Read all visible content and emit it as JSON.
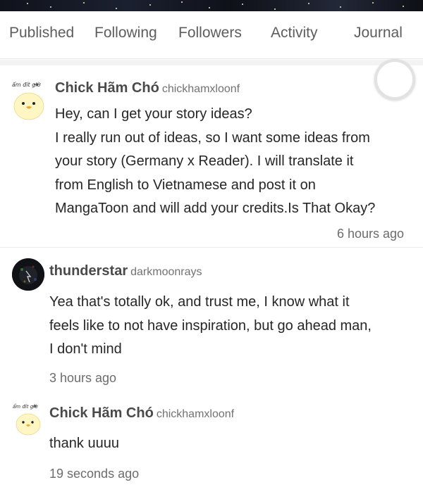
{
  "tabs": [
    {
      "label": "Published"
    },
    {
      "label": "Following"
    },
    {
      "label": "Followers"
    },
    {
      "label": "Activity"
    },
    {
      "label": "Journal"
    }
  ],
  "comments": [
    {
      "author": "Chick Hãm Chó",
      "handle": "chickhamxloonf",
      "avatar_caption": "ẩm đít giờ",
      "lines": [
        "Hey, can I get your story ideas?",
        "I really run out of ideas, so I want some ideas from",
        "your story (Germany x Reader). I will translate it",
        "from English to Vietnamese and post it on",
        "MangaToon and will add your credits.Is That Okay?"
      ],
      "time": "6 hours ago"
    },
    {
      "author": "thunderstar",
      "handle": "darkmoonrays",
      "lines": [
        "Yea that's totally ok, and trust me, I know what it",
        "feels like to not have inspiration, but go ahead man,",
        "I don't mind"
      ],
      "time": "3 hours ago"
    },
    {
      "author": "Chick Hãm Chó",
      "handle": "chickhamxloonf",
      "avatar_caption": "ẩm đít giờ",
      "lines": [
        "thank uuuu"
      ],
      "time": "19 seconds ago"
    }
  ],
  "colors": {
    "tab_text": "#5d5d5d",
    "author_text": "#4a4a4a",
    "meta_text": "#6c6c6c"
  }
}
